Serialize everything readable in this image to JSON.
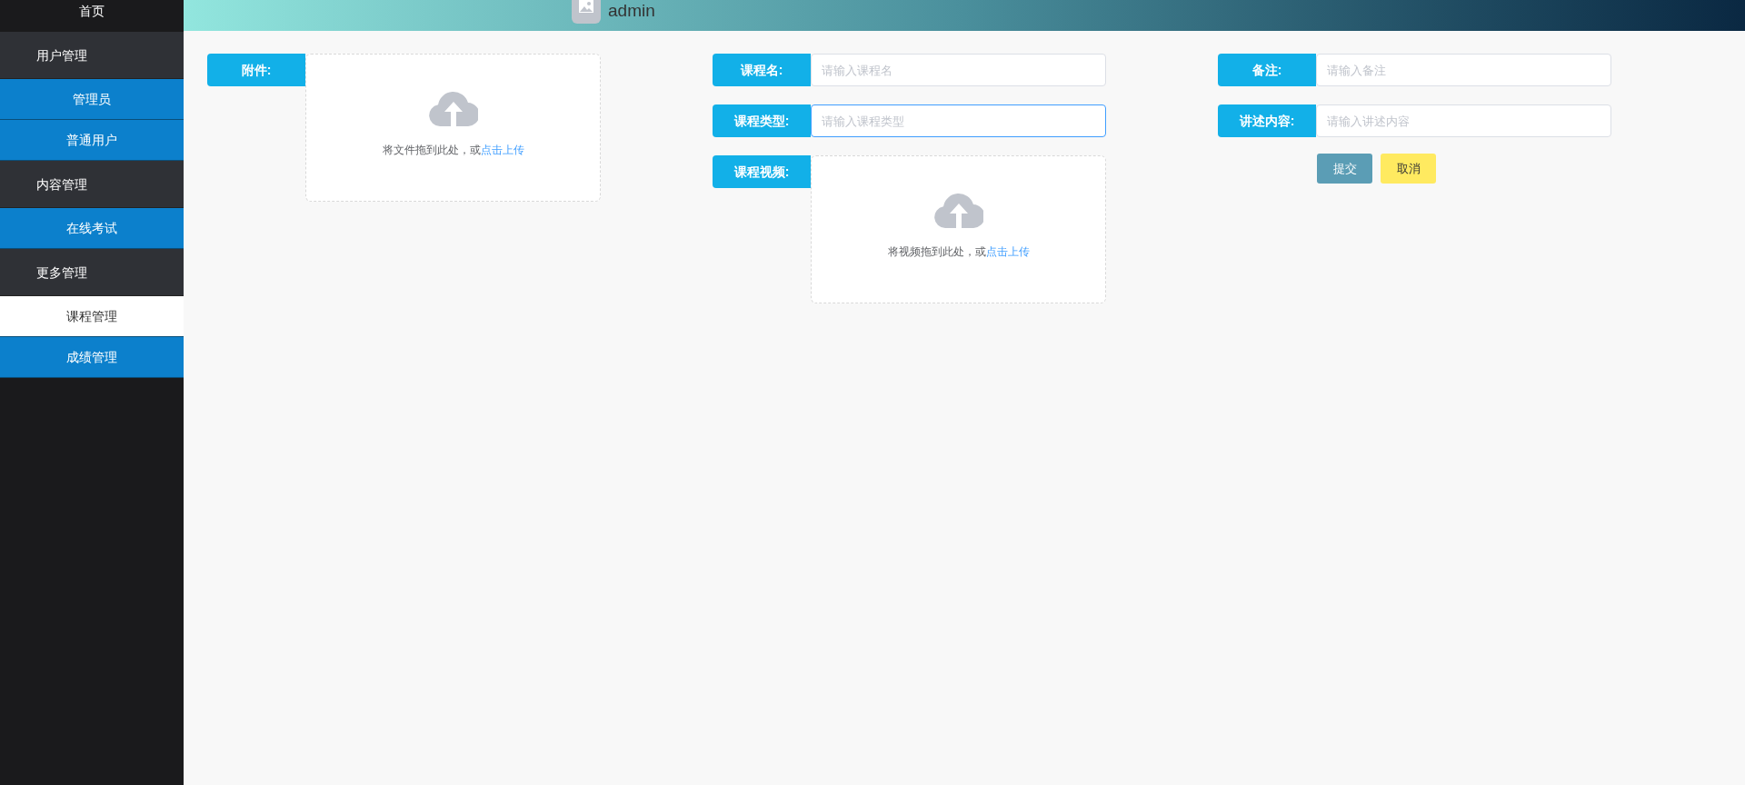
{
  "header": {
    "username": "admin"
  },
  "sidebar": {
    "items": [
      {
        "kind": "home",
        "label": "首页",
        "selected": false
      },
      {
        "kind": "group",
        "label": "用户管理",
        "selected": false
      },
      {
        "kind": "sub",
        "label": "管理员",
        "selected": false
      },
      {
        "kind": "sub",
        "label": "普通用户",
        "selected": false
      },
      {
        "kind": "group",
        "label": "内容管理",
        "selected": false
      },
      {
        "kind": "sub",
        "label": "在线考试",
        "selected": false
      },
      {
        "kind": "group",
        "label": "更多管理",
        "selected": false
      },
      {
        "kind": "sub",
        "label": "课程管理",
        "selected": true
      },
      {
        "kind": "sub",
        "label": "成绩管理",
        "selected": false
      }
    ]
  },
  "form": {
    "columns": [
      [
        {
          "kind": "upload",
          "label": "附件:",
          "hint": "将文件拖到此处，或",
          "link": "点击上传"
        }
      ],
      [
        {
          "kind": "input",
          "label": "课程名:",
          "placeholder": "请输入课程名",
          "focused": false
        },
        {
          "kind": "input",
          "label": "课程类型:",
          "placeholder": "请输入课程类型",
          "focused": true
        },
        {
          "kind": "upload",
          "label": "课程视频:",
          "hint": "将视频拖到此处，或",
          "link": "点击上传"
        }
      ],
      [
        {
          "kind": "input",
          "label": "备注:",
          "placeholder": "请输入备注",
          "focused": false
        },
        {
          "kind": "input",
          "label": "讲述内容:",
          "placeholder": "请输入讲述内容",
          "focused": false
        }
      ]
    ],
    "buttons": [
      {
        "kind": "submit",
        "label": "提交"
      },
      {
        "kind": "cancel",
        "label": "取消"
      }
    ]
  }
}
